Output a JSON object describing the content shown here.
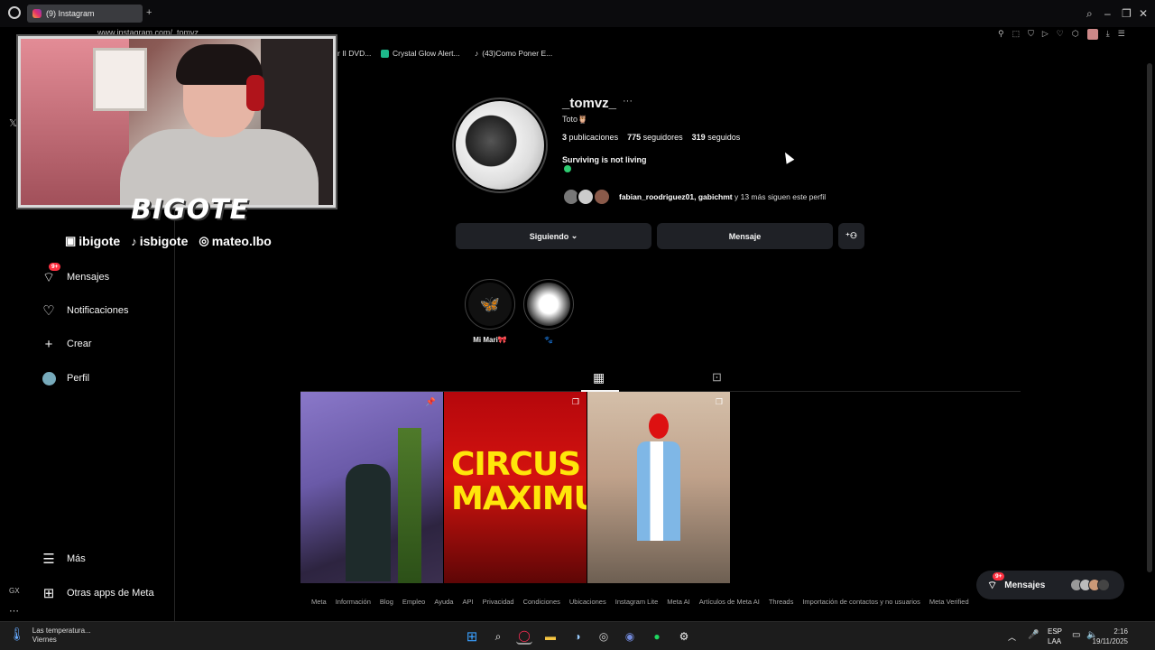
{
  "browser": {
    "tab_title": "(9) Instagram",
    "url": "www.instagram.com/_tomvz_",
    "bookmarks": [
      "r II DVD...",
      "Crystal Glow Alert...",
      "(43)Como Poner E..."
    ]
  },
  "overlay": {
    "brand": "BIGOTE",
    "socials": [
      {
        "icon": "twitch-kick-icon",
        "label": "ibigote"
      },
      {
        "icon": "tiktok-icon",
        "label": "isbigote"
      },
      {
        "icon": "instagram-icon",
        "label": "mateo.lbo"
      }
    ]
  },
  "sidebar": {
    "items": [
      {
        "icon": "messages-icon",
        "label": "Mensajes",
        "badge": "9+"
      },
      {
        "icon": "heart-icon",
        "label": "Notificaciones"
      },
      {
        "icon": "plus-icon",
        "label": "Crear"
      },
      {
        "icon": "profile-avatar",
        "label": "Perfil"
      }
    ],
    "more": "Más",
    "meta_apps": "Otras apps de Meta"
  },
  "profile": {
    "username": "_tomvz_",
    "fullname": "Toto🦉",
    "posts_count": "3",
    "posts_label": "publicaciones",
    "followers_count": "775",
    "followers_label": "seguidores",
    "following_count": "319",
    "following_label": "seguidos",
    "bio": "Surviving is not living",
    "followed_by_names": "fabian_roodriguez01, gabichmt",
    "followed_by_rest": " y 13 más siguen este perfil",
    "following_button": "Siguiendo",
    "message_button": "Mensaje"
  },
  "highlights": [
    {
      "label": "Mi Mari🎀",
      "icon": "butterfly-icon"
    },
    {
      "label": "🐾",
      "icon": "sketch-icon"
    }
  ],
  "posts": [
    {
      "type": "pinned",
      "icon": "pin-icon"
    },
    {
      "type": "carousel",
      "text_top": "CIRCUS",
      "text_bottom": "MAXIMUS",
      "icon": "carousel-icon"
    },
    {
      "type": "carousel",
      "icon": "carousel-icon"
    }
  ],
  "footer": [
    "Meta",
    "Información",
    "Blog",
    "Empleo",
    "Ayuda",
    "API",
    "Privacidad",
    "Condiciones",
    "Ubicaciones",
    "Instagram Lite",
    "Meta AI",
    "Artículos de Meta AI",
    "Threads",
    "Importación de contactos y no usuarios",
    "Meta Verified"
  ],
  "messages_pill": {
    "label": "Mensajes",
    "badge": "9+"
  },
  "taskbar": {
    "weather_title": "Las temperatura...",
    "weather_sub": "Viernes",
    "lang": "ESP",
    "lang_sub": "LAA",
    "time": "2:16",
    "date": "19/11/2025"
  }
}
